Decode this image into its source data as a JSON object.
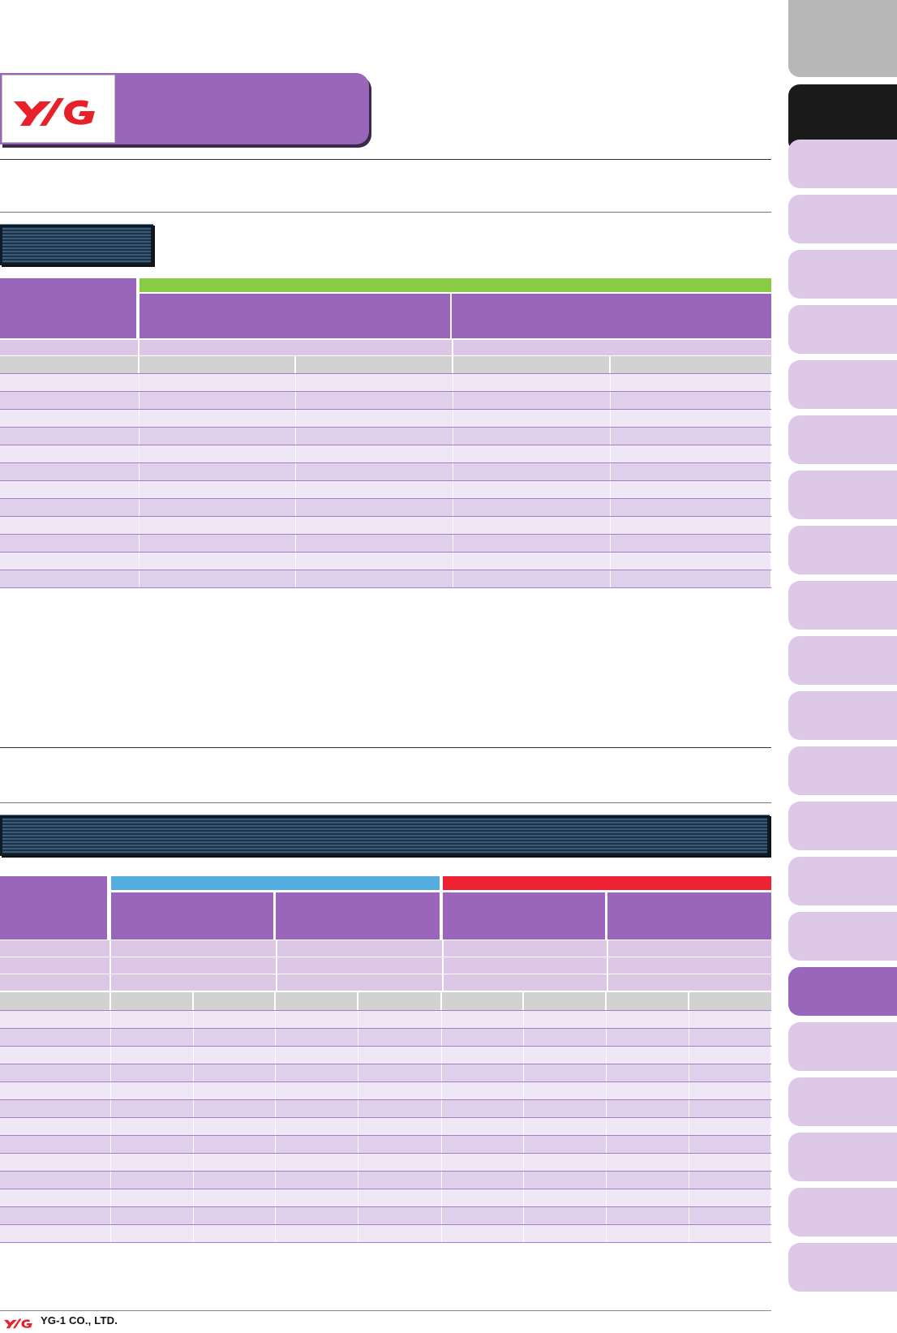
{
  "brand": {
    "logo_text": "YG",
    "logo_color": "#e8202a",
    "company_name": "YG-1 CO., LTD."
  },
  "colors": {
    "header_purple": "#9966bb",
    "lavender": "#dcc8e6",
    "row_light": "#efe6f6",
    "row_dark": "#e0cfeb",
    "green_band": "#88cc44",
    "blue_band": "#55aee0",
    "red_band": "#ee2233",
    "active_tab": "#9966bb",
    "inactive_tab": "#ddc8e8"
  },
  "table1": {
    "rows": 12,
    "columns": 5
  },
  "table2": {
    "rows": 13,
    "columns": 9
  },
  "side_tabs": {
    "count": 23,
    "active_index": 17
  }
}
